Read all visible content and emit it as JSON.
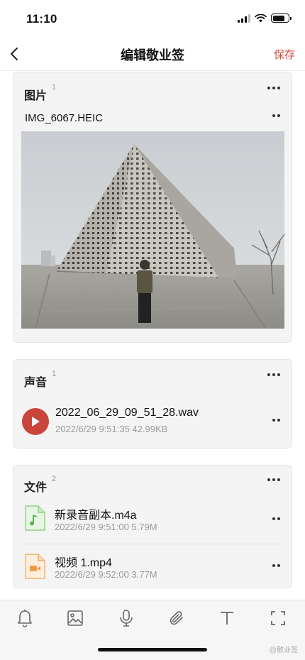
{
  "status": {
    "time": "11:10"
  },
  "nav": {
    "title": "编辑敬业签",
    "save": "保存"
  },
  "image_section": {
    "title": "图片",
    "count": "1",
    "file_name": "IMG_6067.HEIC"
  },
  "audio_section": {
    "title": "声音",
    "count": "1",
    "file_name": "2022_06_29_09_51_28.wav",
    "meta": "2022/6/29 9:51:35  42.99KB"
  },
  "files_section": {
    "title": "文件",
    "count": "2",
    "items": [
      {
        "name": "新录音副本.m4a",
        "meta": "2022/6/29 9:51:00  5.79M",
        "icon": "audio-file-icon"
      },
      {
        "name": "视频 1.mp4",
        "meta": "2022/6/29 9:52:00  3.77M",
        "icon": "video-file-icon"
      }
    ]
  },
  "toolbar": {
    "icons": [
      "bell-icon",
      "image-icon",
      "microphone-icon",
      "paperclip-icon",
      "text-icon",
      "fullscreen-icon"
    ]
  },
  "watermark": "@敬业签",
  "colors": {
    "accent": "#d24b3e",
    "play": "#c9453b",
    "card_bg": "#f4f4f4"
  }
}
